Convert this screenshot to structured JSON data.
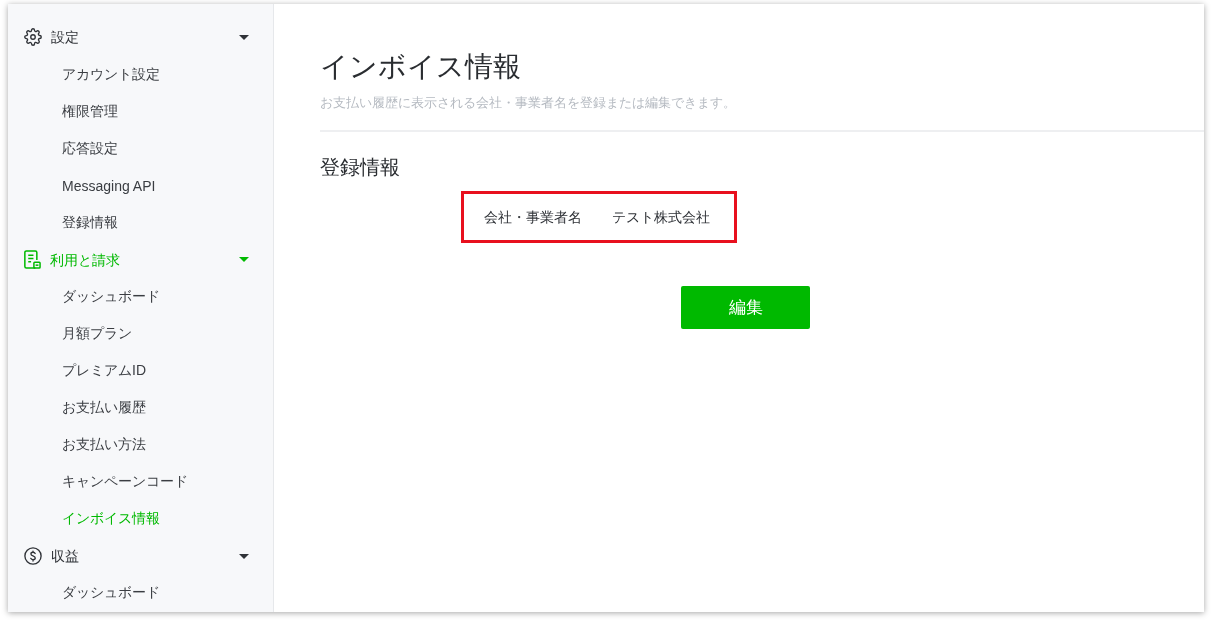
{
  "sidebar": {
    "groups": [
      {
        "label": "設定",
        "active": false,
        "expanded": true,
        "items": [
          {
            "label": "アカウント設定",
            "selected": false
          },
          {
            "label": "権限管理",
            "selected": false
          },
          {
            "label": "応答設定",
            "selected": false
          },
          {
            "label": "Messaging API",
            "selected": false
          },
          {
            "label": "登録情報",
            "selected": false
          }
        ]
      },
      {
        "label": "利用と請求",
        "active": true,
        "expanded": true,
        "items": [
          {
            "label": "ダッシュボード",
            "selected": false
          },
          {
            "label": "月額プラン",
            "selected": false
          },
          {
            "label": "プレミアムID",
            "selected": false
          },
          {
            "label": "お支払い履歴",
            "selected": false
          },
          {
            "label": "お支払い方法",
            "selected": false
          },
          {
            "label": "キャンペーンコード",
            "selected": false
          },
          {
            "label": "インボイス情報",
            "selected": true
          }
        ]
      },
      {
        "label": "収益",
        "active": false,
        "expanded": true,
        "items": [
          {
            "label": "ダッシュボード",
            "selected": false
          }
        ]
      }
    ]
  },
  "page": {
    "title": "インボイス情報",
    "subtitle": "お支払い履歴に表示される会社・事業者名を登録または編集できます。",
    "section": {
      "heading": "登録情報",
      "fields": [
        {
          "label": "会社・事業者名",
          "value": "テスト株式会社",
          "highlighted": true
        }
      ],
      "button": "編集"
    }
  }
}
